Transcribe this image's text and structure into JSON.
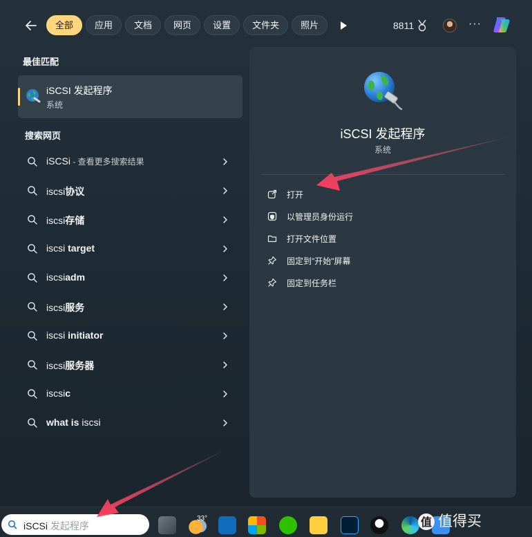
{
  "filter_bar": {
    "chips": [
      "全部",
      "应用",
      "文档",
      "网页",
      "设置",
      "文件夹",
      "照片"
    ],
    "active_chip": "全部",
    "points": "8811",
    "more": "···"
  },
  "best_match": {
    "section_title": "最佳匹配",
    "name": "iSCSI 发起程序",
    "subtitle": "系统"
  },
  "web_search": {
    "section_title": "搜索网页",
    "items": [
      {
        "prefix": "iSCSi",
        "bold": "",
        "suffix": " - 查看更多搜索结果"
      },
      {
        "prefix": "iscsi",
        "bold": "协议",
        "suffix": ""
      },
      {
        "prefix": "iscsi",
        "bold": "存储",
        "suffix": ""
      },
      {
        "prefix": "iscsi",
        "bold": " target",
        "suffix": ""
      },
      {
        "prefix": "iscsi",
        "bold": "adm",
        "suffix": ""
      },
      {
        "prefix": "iscsi",
        "bold": "服务",
        "suffix": ""
      },
      {
        "prefix": "iscsi",
        "bold": " initiator",
        "suffix": ""
      },
      {
        "prefix": "iscsi",
        "bold": "服务器",
        "suffix": ""
      },
      {
        "prefix": "iscsi",
        "bold": "c",
        "suffix": ""
      },
      {
        "prefix": "",
        "bold": "what is ",
        "suffix": "iscsi"
      }
    ]
  },
  "preview": {
    "title": "iSCSI 发起程序",
    "subtitle": "系统",
    "actions": [
      {
        "label": "打开",
        "icon": "open-icon"
      },
      {
        "label": "以管理员身份运行",
        "icon": "shield-icon"
      },
      {
        "label": "打开文件位置",
        "icon": "folder-icon"
      },
      {
        "label": "固定到\"开始\"屏幕",
        "icon": "pin-icon"
      },
      {
        "label": "固定到任务栏",
        "icon": "pin-icon"
      }
    ]
  },
  "taskbar": {
    "search_typed": "iSCSi",
    "search_hint": " 发起程序",
    "weather_temp": "33°",
    "icons": [
      "task-view-icon",
      "weather-icon",
      "outlook-icon",
      "store-icon",
      "wechat-icon",
      "app-g-icon",
      "photoshop-icon",
      "qq-icon",
      "edge-icon",
      "arrow-app-icon"
    ]
  },
  "watermark": "值得买",
  "colors": {
    "accent_yellow": "#ffd67e",
    "arrow_red": "#ff3b5c",
    "panel": "#2b3841"
  }
}
